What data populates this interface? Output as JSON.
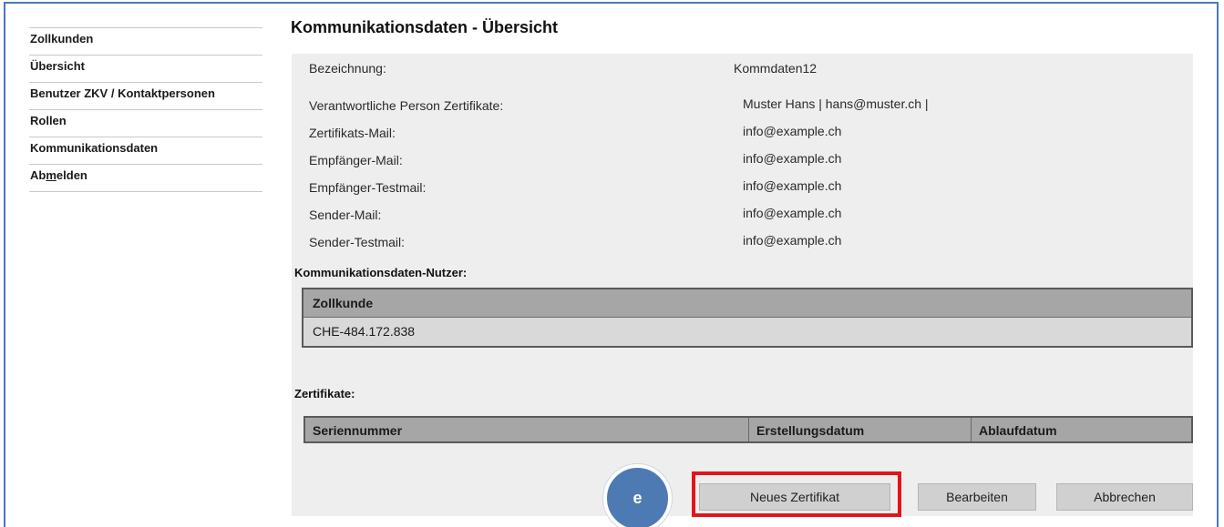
{
  "sidebar": {
    "items": [
      {
        "label": "Zollkunden"
      },
      {
        "label": "Übersicht"
      },
      {
        "label": "Benutzer ZKV / Kontaktpersonen"
      },
      {
        "label": "Rollen"
      },
      {
        "label": "Kommunikationsdaten"
      },
      {
        "label_pre": "Ab",
        "label_u": "m",
        "label_post": "elden"
      }
    ]
  },
  "page": {
    "title": "Kommunikationsdaten - Übersicht"
  },
  "details": [
    {
      "label": "Bezeichnung:",
      "value": "Kommdaten12"
    },
    {
      "label": "Verantwortliche Person Zertifikate:",
      "value": "Muster Hans | hans@muster.ch |"
    },
    {
      "label": "Zertifikats-Mail:",
      "value": "info@example.ch"
    },
    {
      "label": "Empfänger-Mail:",
      "value": "info@example.ch"
    },
    {
      "label": "Empfänger-Testmail:",
      "value": "info@example.ch"
    },
    {
      "label": "Sender-Mail:",
      "value": "info@example.ch"
    },
    {
      "label": "Sender-Testmail:",
      "value": "info@example.ch"
    }
  ],
  "users_section": {
    "label": "Kommunikationsdaten-Nutzer:",
    "header": "Zollkunde",
    "rows": [
      "CHE-484.172.838"
    ]
  },
  "certs_section": {
    "label": "Zertifikate:",
    "columns": [
      "Seriennummer",
      "Erstellungsdatum",
      "Ablaufdatum"
    ]
  },
  "buttons": {
    "new_cert": "Neues Zertifikat",
    "edit": "Bearbeiten",
    "cancel": "Abbrechen"
  },
  "annotation": {
    "marker_label": "e",
    "highlight_color": "#e4141b",
    "marker_color": "#4d7ab2"
  }
}
